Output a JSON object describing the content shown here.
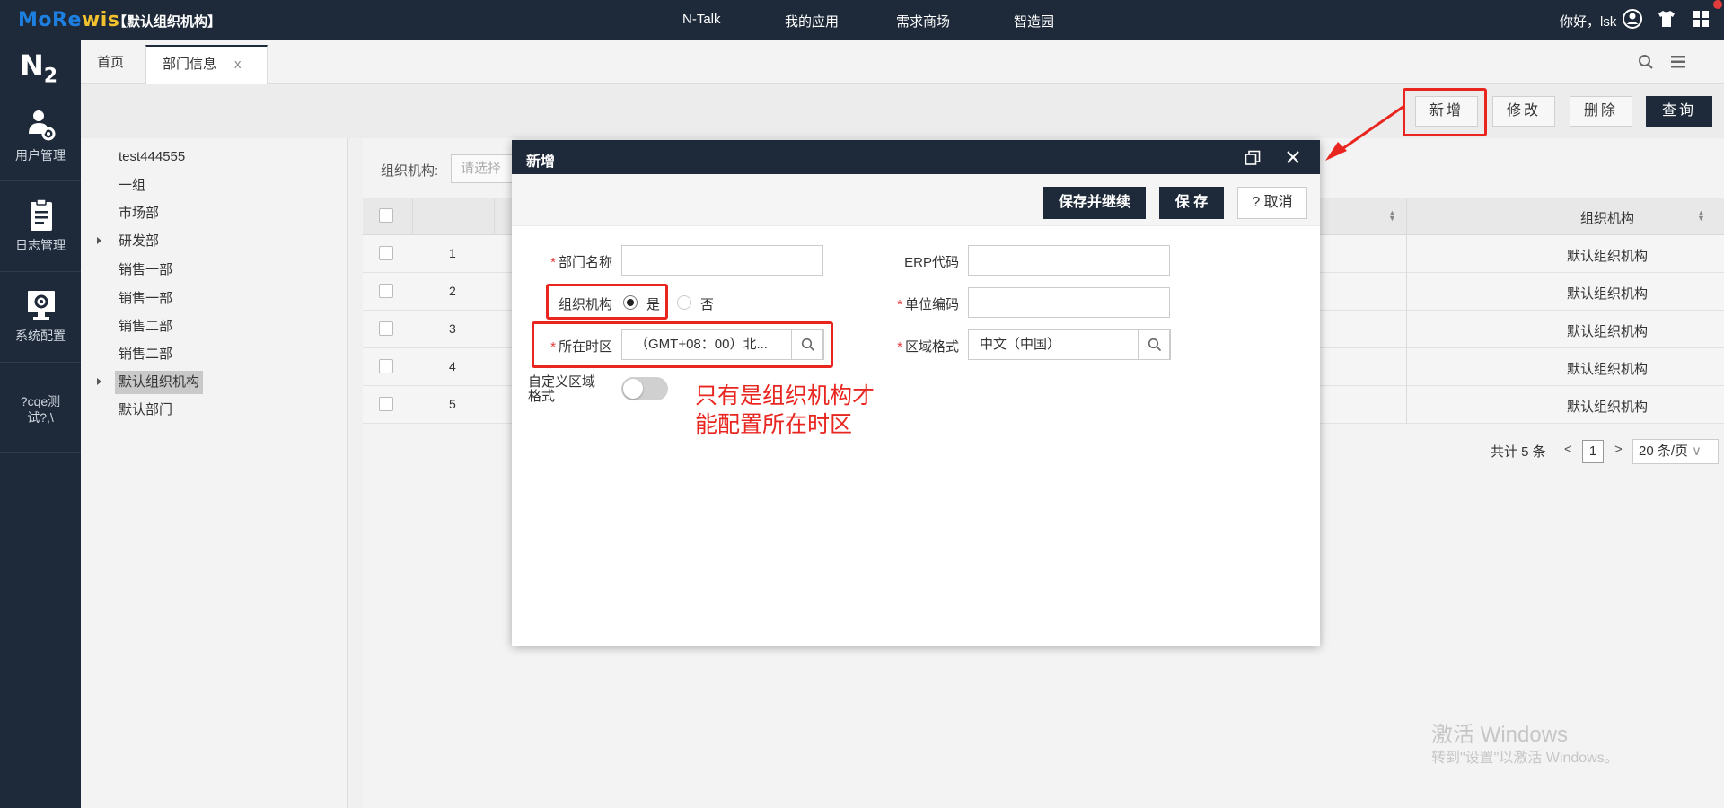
{
  "app": {
    "logo_part1": "MoRe",
    "logo_part2": "wis",
    "org_title": "【默认组织机构】"
  },
  "topnav": [
    "N-Talk",
    "我的应用",
    "需求商场",
    "智造园"
  ],
  "user": {
    "greeting": "你好，lsk"
  },
  "sidebar": {
    "logo": "N",
    "logo_sub": "2",
    "items": [
      {
        "label": "用户管理",
        "icon": "user-gear-icon"
      },
      {
        "label": "日志管理",
        "icon": "clipboard-icon"
      },
      {
        "label": "系统配置",
        "icon": "monitor-gear-icon"
      }
    ],
    "extra_line1": "?cqe测",
    "extra_line2": "试?,\\"
  },
  "tabs": [
    {
      "label": "首页",
      "active": false
    },
    {
      "label": "部门信息",
      "active": true,
      "close": "x"
    }
  ],
  "toolbar": {
    "add": "新增",
    "edit": "修改",
    "delete": "删除",
    "query": "查询"
  },
  "tree": {
    "items": [
      {
        "label": "test444555",
        "caret": false,
        "selected": false
      },
      {
        "label": "一组",
        "caret": false,
        "selected": false
      },
      {
        "label": "市场部",
        "caret": false,
        "selected": false
      },
      {
        "label": "研发部",
        "caret": true,
        "selected": false
      },
      {
        "label": "销售一部",
        "caret": false,
        "selected": false
      },
      {
        "label": "销售一部",
        "caret": false,
        "selected": false
      },
      {
        "label": "销售二部",
        "caret": false,
        "selected": false
      },
      {
        "label": "销售二部",
        "caret": false,
        "selected": false
      },
      {
        "label": "默认组织机构",
        "caret": true,
        "selected": true
      },
      {
        "label": "默认部门",
        "caret": false,
        "selected": false
      }
    ]
  },
  "grid": {
    "filter_label": "组织机构:",
    "filter_placeholder": "请选择",
    "org_column": "组织机构",
    "rows": [
      {
        "num": "1",
        "org": "默认组织机构"
      },
      {
        "num": "2",
        "org": "默认组织机构"
      },
      {
        "num": "3",
        "org": "默认组织机构"
      },
      {
        "num": "4",
        "org": "默认组织机构"
      },
      {
        "num": "5",
        "org": "默认组织机构"
      }
    ],
    "pager": {
      "total": "共计 5 条",
      "page": "1",
      "per_page": "20 条/页"
    }
  },
  "modal": {
    "title": "新增",
    "save_continue": "保存并继续",
    "save": "保 存",
    "cancel": "? 取消",
    "fields": {
      "dept_name": {
        "label": "部门名称",
        "value": ""
      },
      "erp_code": {
        "label": "ERP代码",
        "value": ""
      },
      "is_org": {
        "label": "组织机构",
        "yes": "是",
        "no": "否",
        "selected": "是"
      },
      "unit_code": {
        "label": "单位编码",
        "value": ""
      },
      "timezone": {
        "label": "所在时区",
        "value": "（GMT+08：00）北..."
      },
      "locale": {
        "label": "区域格式",
        "value": "中文（中国）"
      },
      "custom_locale": {
        "label_line1": "自定义区域",
        "label_line2": "格式",
        "on": false
      }
    }
  },
  "annotation": {
    "line1": "只有是组织机构才",
    "line2": "能配置所在时区"
  },
  "watermark": {
    "line1": "激活 Windows",
    "line2": "转到\"设置\"以激活 Windows。"
  },
  "colors": {
    "header_bg": "#1e2a3a",
    "annotation_red": "#e8261f",
    "required": "#e23b3b"
  }
}
